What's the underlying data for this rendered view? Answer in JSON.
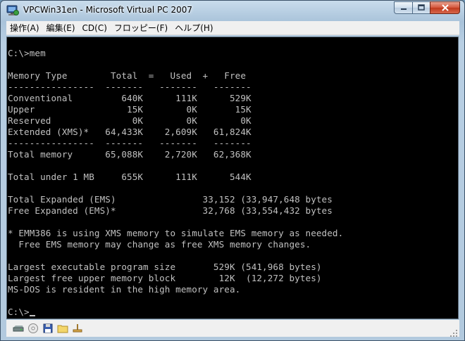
{
  "window": {
    "title": "VPCWin31en - Microsoft Virtual PC 2007",
    "icon": "virtual-pc-icon"
  },
  "menu": {
    "items": [
      {
        "label": "操作(A)"
      },
      {
        "label": "編集(E)"
      },
      {
        "label": "CD(C)"
      },
      {
        "label": "フロッピー(F)"
      },
      {
        "label": "ヘルプ(H)"
      }
    ]
  },
  "console": {
    "lines": [
      "C:\\>mem",
      "",
      "Memory Type        Total  =   Used  +   Free",
      "----------------  -------   -------   -------",
      "Conventional         640K      111K      529K",
      "Upper                 15K        0K       15K",
      "Reserved               0K        0K        0K",
      "Extended (XMS)*   64,433K    2,609K   61,824K",
      "----------------  -------   -------   -------",
      "Total memory      65,088K    2,720K   62,368K",
      "",
      "Total under 1 MB     655K      111K      544K",
      "",
      "Total Expanded (EMS)                33,152 (33,947,648 bytes",
      "Free Expanded (EMS)*                32,768 (33,554,432 bytes",
      "",
      "* EMM386 is using XMS memory to simulate EMS memory as needed.",
      "  Free EMS memory may change as free XMS memory changes.",
      "",
      "Largest executable program size       529K (541,968 bytes)",
      "Largest free upper memory block        12K  (12,272 bytes)",
      "MS-DOS is resident in the high memory area.",
      "",
      "C:\\>"
    ],
    "fg_color": "#c0c0c0",
    "bg_color": "#000000"
  },
  "statusbar": {
    "icons": [
      "hard-disk-icon",
      "cd-drive-icon",
      "floppy-icon",
      "shared-folder-icon",
      "network-icon"
    ]
  }
}
